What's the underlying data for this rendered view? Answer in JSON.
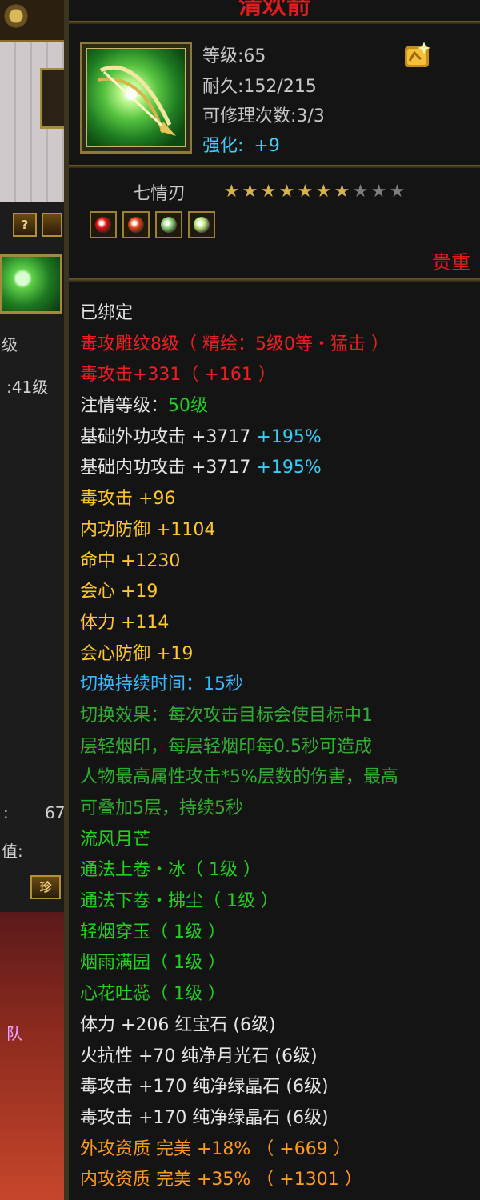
{
  "left_panel": {
    "btn_help": "?",
    "text_level_suffix": "级",
    "text_level_value": ":41级",
    "text_value_1": ":",
    "text_value_67": "67",
    "text_value_label": "值:",
    "btn_treasure": "珍",
    "text_team": "队"
  },
  "item": {
    "title": "清欢箭",
    "level": "等级:65",
    "durability": "耐久:152/215",
    "repair": "可修理次数:3/3",
    "enhance_label": "强化:",
    "enhance_value": "+9",
    "weapon_name": "七情刃",
    "stars_filled": 7,
    "stars_total": 10,
    "rarity": "贵重",
    "gem_colors": [
      "#d11",
      "#e14418",
      "#8fd07a",
      "#bde680"
    ],
    "badge_icon": "gold-sparkle-icon"
  },
  "details": [
    {
      "segments": [
        {
          "t": "已绑定",
          "c": "white"
        }
      ]
    },
    {
      "segments": [
        {
          "t": "毒攻雕纹8级（ 精绘：5级0等・猛击 ）",
          "c": "red"
        }
      ]
    },
    {
      "segments": [
        {
          "t": "毒攻击+331（ +161 ）",
          "c": "red"
        }
      ]
    },
    {
      "segments": [
        {
          "t": "注情等级：",
          "c": "white"
        },
        {
          "t": "50级",
          "c": "green"
        }
      ]
    },
    {
      "segments": [
        {
          "t": "基础外功攻击 +3717 ",
          "c": "white"
        },
        {
          "t": "+195%",
          "c": "cyan"
        }
      ]
    },
    {
      "segments": [
        {
          "t": "基础内功攻击 +3717 ",
          "c": "white"
        },
        {
          "t": "+195%",
          "c": "cyan"
        }
      ]
    },
    {
      "segments": [
        {
          "t": "毒攻击 +96",
          "c": "yellow"
        }
      ]
    },
    {
      "segments": [
        {
          "t": "内功防御 +1104",
          "c": "yellow"
        }
      ]
    },
    {
      "segments": [
        {
          "t": "命中 +1230",
          "c": "yellow"
        }
      ]
    },
    {
      "segments": [
        {
          "t": "会心 +19",
          "c": "yellow"
        }
      ]
    },
    {
      "segments": [
        {
          "t": "体力 +114",
          "c": "yellow"
        }
      ]
    },
    {
      "segments": [
        {
          "t": "会心防御 +19",
          "c": "yellow"
        }
      ]
    },
    {
      "segments": [
        {
          "t": "切换持续时间：15秒",
          "c": "blue"
        }
      ]
    },
    {
      "segments": [
        {
          "t": "切换效果：每次攻击目标会使目标中1",
          "c": "dkgreen"
        }
      ]
    },
    {
      "segments": [
        {
          "t": "层轻烟印，每层轻烟印每0.5秒可造成",
          "c": "dkgreen"
        }
      ]
    },
    {
      "segments": [
        {
          "t": "人物最高属性攻击*5%层数的伤害，最高",
          "c": "dkgreen"
        }
      ]
    },
    {
      "segments": [
        {
          "t": "可叠加5层，持续5秒",
          "c": "dkgreen"
        }
      ]
    },
    {
      "segments": [
        {
          "t": "流风月芒",
          "c": "green"
        }
      ]
    },
    {
      "segments": [
        {
          "t": "通法上卷・冰（ 1级 ）",
          "c": "green"
        }
      ]
    },
    {
      "segments": [
        {
          "t": "通法下卷・拂尘（ 1级 ）",
          "c": "green"
        }
      ]
    },
    {
      "segments": [
        {
          "t": "轻烟穿玉（ 1级 ）",
          "c": "green"
        }
      ]
    },
    {
      "segments": [
        {
          "t": "烟雨满园（ 1级 ）",
          "c": "green"
        }
      ]
    },
    {
      "segments": [
        {
          "t": "心花吐蕊（ 1级 ）",
          "c": "green"
        }
      ]
    },
    {
      "segments": [
        {
          "t": "体力 +206 红宝石 (6级)",
          "c": "white"
        }
      ]
    },
    {
      "segments": [
        {
          "t": "火抗性 +70 纯净月光石 (6级)",
          "c": "white"
        }
      ]
    },
    {
      "segments": [
        {
          "t": "毒攻击 +170 纯净绿晶石 (6级)",
          "c": "white"
        }
      ]
    },
    {
      "segments": [
        {
          "t": "毒攻击 +170 纯净绿晶石 (6级)",
          "c": "white"
        }
      ]
    },
    {
      "segments": [
        {
          "t": "外攻资质 完美 +18% （ +669 ）",
          "c": "orange"
        }
      ]
    },
    {
      "segments": [
        {
          "t": "内攻资质 完美 +35% （ +1301 ）",
          "c": "orange"
        }
      ]
    }
  ]
}
